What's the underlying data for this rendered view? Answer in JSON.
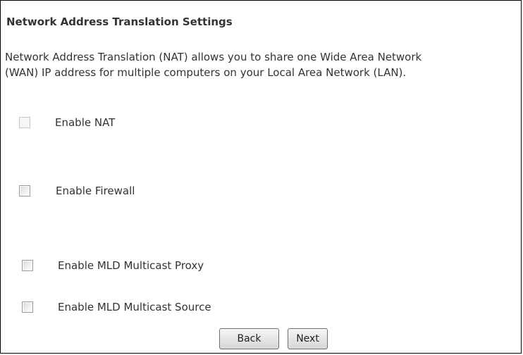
{
  "page": {
    "title": "Network Address Translation Settings",
    "description": [
      "Network Address Translation (NAT) allows you to share one Wide Area Network",
      "(WAN) IP address for multiple computers on your Local Area Network (LAN)."
    ]
  },
  "options": {
    "nat": {
      "label": "Enable NAT",
      "checked": false
    },
    "firewall": {
      "label": "Enable Firewall",
      "checked": false
    },
    "mld_proxy": {
      "label": "Enable MLD Multicast Proxy",
      "checked": false
    },
    "mld_source": {
      "label": "Enable MLD Multicast Source",
      "checked": false
    }
  },
  "buttons": {
    "back_label": "Back",
    "next_label": "Next"
  }
}
